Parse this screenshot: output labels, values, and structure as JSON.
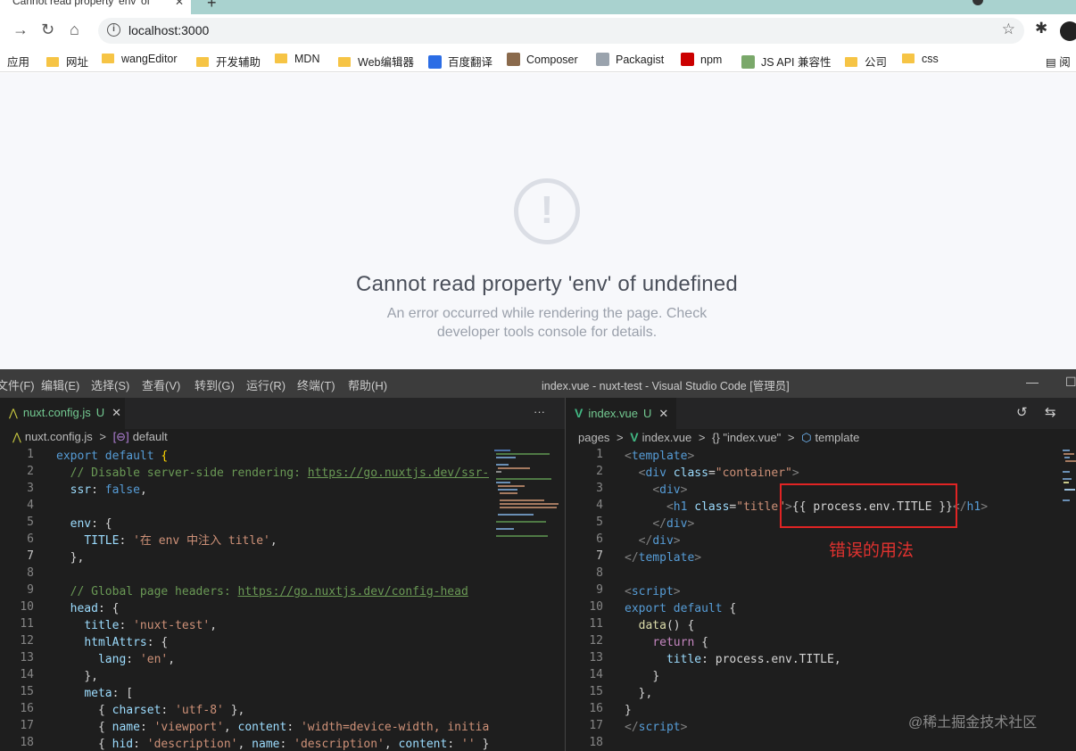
{
  "browser": {
    "tab_title": "Cannot read property 'env' of",
    "url": "localhost:3000",
    "bookmarks": [
      {
        "label": "应用",
        "kind": "apps"
      },
      {
        "label": "网址",
        "kind": "folder"
      },
      {
        "label": "wangEditor",
        "kind": "folder"
      },
      {
        "label": "开发辅助",
        "kind": "folder"
      },
      {
        "label": "MDN",
        "kind": "folder"
      },
      {
        "label": "Web编辑器",
        "kind": "folder"
      },
      {
        "label": "百度翻译",
        "kind": "site"
      },
      {
        "label": "Composer",
        "kind": "site"
      },
      {
        "label": "Packagist",
        "kind": "site"
      },
      {
        "label": "npm",
        "kind": "site"
      },
      {
        "label": "JS API 兼容性",
        "kind": "site"
      },
      {
        "label": "公司",
        "kind": "folder"
      },
      {
        "label": "css",
        "kind": "folder"
      },
      {
        "label": "阅",
        "kind": "reading-list"
      }
    ]
  },
  "page": {
    "error_title": "Cannot read property 'env' of undefined",
    "error_desc_1": "An error occurred while rendering the page. Check",
    "error_desc_2": "developer tools console for details."
  },
  "vscode": {
    "menu": [
      "文件(F)",
      "编辑(E)",
      "选择(S)",
      "查看(V)",
      "转到(G)",
      "运行(R)",
      "终端(T)",
      "帮助(H)"
    ],
    "window_title": "index.vue - nuxt-test - Visual Studio Code [管理员]",
    "left": {
      "tab": "nuxt.config.js",
      "tab_badge": "U",
      "more": "···",
      "breadcrumb": [
        "nuxt.config.js",
        ">",
        "default"
      ]
    },
    "right": {
      "tab": "index.vue",
      "tab_badge": "U",
      "breadcrumb": [
        "pages",
        ">",
        "index.vue",
        ">",
        "{} \"index.vue\"",
        ">",
        "template"
      ]
    },
    "annotation": "错误的用法"
  },
  "watermark": "@稀土掘金技术社区"
}
